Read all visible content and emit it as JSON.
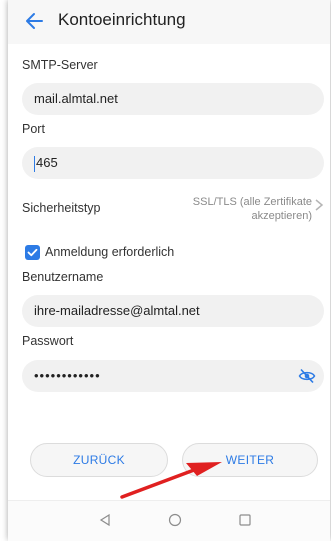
{
  "header": {
    "title": "Kontoeinrichtung"
  },
  "fields": {
    "smtp_label": "SMTP-Server",
    "smtp_value": "mail.almtal.net",
    "port_label": "Port",
    "port_value": "465",
    "security_label": "Sicherheitstyp",
    "security_value_line1": "SSL/TLS (alle Zertifikate",
    "security_value_line2": "akzeptieren)",
    "login_required_label": "Anmeldung erforderlich",
    "login_required_checked": true,
    "username_label": "Benutzername",
    "username_value": "ihre-mailadresse@almtal.net",
    "password_label": "Passwort",
    "password_masked": "••••••••••••"
  },
  "buttons": {
    "back_label": "ZURÜCK",
    "next_label": "WEITER"
  },
  "icons": {
    "back": "arrow-left-icon",
    "chevron": "chevron-right-icon",
    "checkbox": "checkbox-checked-icon",
    "eye": "eye-off-icon",
    "nav_back": "triangle-back-icon",
    "nav_home": "circle-home-icon",
    "nav_recent": "square-recent-icon"
  },
  "colors": {
    "accent": "#2d7be5",
    "annotation_arrow": "#e02020"
  }
}
